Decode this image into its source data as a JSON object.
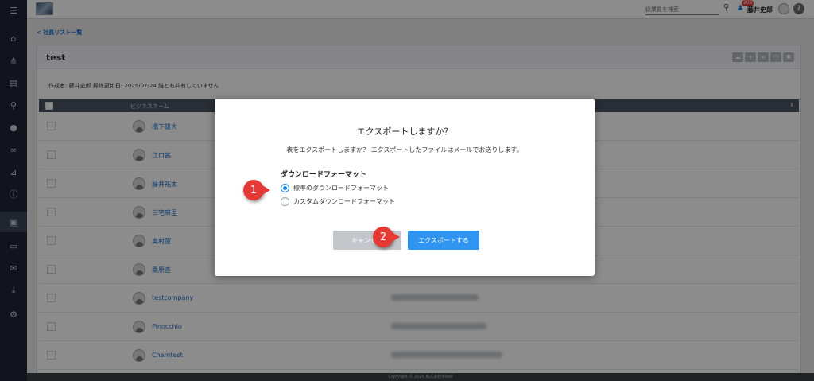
{
  "topbar": {
    "search_placeholder": "従業員を検索",
    "notif_count": "205",
    "user_name": "藤井史郎",
    "help_label": "?"
  },
  "nav": {
    "back_link": "< 社員リスト一覧"
  },
  "card": {
    "title": "test",
    "meta": "作成者: 藤井史郎  最終更新日: 2025/07/24  誰とも共有していません",
    "table_header_name": "ビジネスネーム",
    "rows": [
      {
        "name": "橋下雄大"
      },
      {
        "name": "江口茜"
      },
      {
        "name": "藤井祐太"
      },
      {
        "name": "三宅麻里"
      },
      {
        "name": "奥村蓮"
      },
      {
        "name": "桑原杏"
      },
      {
        "name": "testcompany"
      },
      {
        "name": "Pinocchio"
      },
      {
        "name": "Chamtest"
      }
    ]
  },
  "footer": {
    "copyright": "Copyright © 2025 株式会社Misoll"
  },
  "modal": {
    "title": "エクスポートしますか？",
    "description": "表をエクスポートしますか？ エクスポートしたファイルはメールでお送りします。",
    "format_label": "ダウンロードフォーマット",
    "options": [
      {
        "label": "標準のダウンロードフォーマット",
        "checked": true
      },
      {
        "label": "カスタムダウンロードフォーマット",
        "checked": false
      }
    ],
    "cancel_label": "キャンセル",
    "export_label": "エクスポートする"
  },
  "annotations": {
    "step1": "1",
    "step2": "2"
  },
  "colors": {
    "primary": "#2f95f0",
    "marker": "#e53935",
    "sidebar": "#1f2633"
  }
}
